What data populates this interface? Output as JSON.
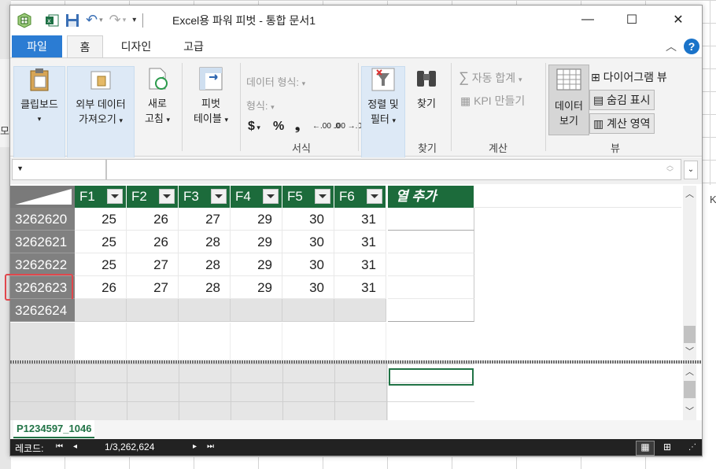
{
  "window": {
    "title": "Excel용 파워 피벗 - 통합 문서1",
    "minimize": "—",
    "maximize": "☐",
    "close": "✕"
  },
  "tabs": {
    "file": "파일",
    "home": "홈",
    "design": "디자인",
    "advanced": "고급"
  },
  "ribbon": {
    "clipboard": "클립보드",
    "get_external_line1": "외부 데이터",
    "get_external_line2": "가져오기",
    "refresh_line1": "새로",
    "refresh_line2": "고침",
    "pivot_line1": "피벗",
    "pivot_line2": "테이블",
    "data_type": "데이터 형식:",
    "format": "형식:",
    "currency": "$",
    "percent": "%",
    "comma": "❟",
    "inc_decimal": "←.00 .0",
    "dec_decimal": ".00 →.0",
    "format_group": "서식",
    "sort_filter_line1": "정렬 및",
    "sort_filter_line2": "필터",
    "find": "찾기",
    "find_group": "찾기",
    "autosum": "자동 합계",
    "kpi": "KPI 만들기",
    "calc_group": "계산",
    "data_view_line1": "데이터",
    "data_view_line2": "보기",
    "diagram_view": "다이어그램 뷰",
    "show_hidden": "숨김 표시",
    "calc_area": "계산 영역",
    "view_group": "뷰"
  },
  "table": {
    "columns": [
      "F1",
      "F2",
      "F3",
      "F4",
      "F5",
      "F6"
    ],
    "add_column": "열 추가",
    "rows": [
      {
        "id": "3262620",
        "values": [
          "25",
          "26",
          "27",
          "29",
          "30",
          "31"
        ]
      },
      {
        "id": "3262621",
        "values": [
          "25",
          "26",
          "28",
          "29",
          "30",
          "31"
        ]
      },
      {
        "id": "3262622",
        "values": [
          "25",
          "27",
          "28",
          "29",
          "30",
          "31"
        ]
      },
      {
        "id": "3262623",
        "values": [
          "26",
          "27",
          "28",
          "29",
          "30",
          "31"
        ]
      },
      {
        "id": "3262624",
        "values": [
          "",
          "",
          "",
          "",
          "",
          ""
        ]
      }
    ],
    "selected_row_id": "3262623"
  },
  "sheet_tab": "P1234597_1046",
  "status": {
    "record_label": "레코드:",
    "record_position": "1/3,262,624"
  },
  "background": {
    "row_label": "모",
    "col_label": "K"
  },
  "colors": {
    "header_green": "#1c6b3b",
    "accent_blue": "#2b7cd3",
    "highlight_red": "#e0474c"
  }
}
